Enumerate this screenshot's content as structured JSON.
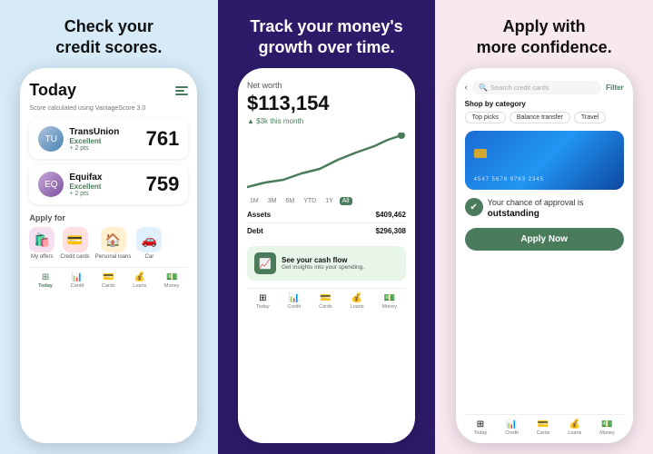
{
  "panel1": {
    "title": "Check your\ncredit scores.",
    "today": "Today",
    "scoreSubtext": "Score calculated using VantageScore 3.0",
    "scores": [
      {
        "bureau": "TransUnion",
        "rating": "Excellent",
        "pts": "+ 2 pts",
        "number": "761"
      },
      {
        "bureau": "Equifax",
        "rating": "Excellent",
        "pts": "+ 2 pts",
        "number": "759"
      }
    ],
    "applyFor": "Apply for",
    "applyItems": [
      {
        "icon": "🛍️",
        "label": "My offers"
      },
      {
        "icon": "💳",
        "label": "Credit cards"
      },
      {
        "icon": "🏠",
        "label": "Personal loans"
      },
      {
        "icon": "🚗",
        "label": "Car"
      }
    ],
    "navItems": [
      {
        "icon": "⊞",
        "label": "Today",
        "active": true
      },
      {
        "icon": "📊",
        "label": "Credit"
      },
      {
        "icon": "💳",
        "label": "Cards"
      },
      {
        "icon": "💰",
        "label": "Loans"
      },
      {
        "icon": "💵",
        "label": "Money"
      }
    ]
  },
  "panel2": {
    "title": "Track your money's\ngrowth over time.",
    "netWorthLabel": "Net worth",
    "netWorthValue": "$113,154",
    "netWorthChange": "▲ $3k this month",
    "chartTabs": [
      "1M",
      "3M",
      "6M",
      "YTD",
      "1Y",
      "All"
    ],
    "activeTab": "All",
    "finances": [
      {
        "label": "Assets",
        "value": "$409,462"
      },
      {
        "label": "Debt",
        "value": "$296,308"
      }
    ],
    "cashFlow": {
      "title": "See your cash flow",
      "subtitle": "Get insights into your spending."
    },
    "navItems": [
      {
        "icon": "⊞",
        "label": "Today"
      },
      {
        "icon": "📊",
        "label": "Credit"
      },
      {
        "icon": "💳",
        "label": "Cards"
      },
      {
        "icon": "💰",
        "label": "Loans"
      },
      {
        "icon": "💵",
        "label": "Money"
      }
    ]
  },
  "panel3": {
    "title": "Apply with\nmore confidence.",
    "searchPlaceholder": "Search credit cards",
    "filterLabel": "Filter",
    "shopByCategory": "Shop by category",
    "categoryPills": [
      "Top picks",
      "Balance transfer",
      "Travel"
    ],
    "cardNumber": "4547 5678 9763 2345",
    "approvalText": "Your chance of approval is",
    "approvalStrong": "outstanding",
    "applyNowLabel": "Apply Now",
    "navItems": [
      {
        "icon": "⊞",
        "label": "Today"
      },
      {
        "icon": "📊",
        "label": "Credit"
      },
      {
        "icon": "💳",
        "label": "Cards"
      },
      {
        "icon": "💰",
        "label": "Loans"
      },
      {
        "icon": "💵",
        "label": "Money"
      }
    ]
  }
}
